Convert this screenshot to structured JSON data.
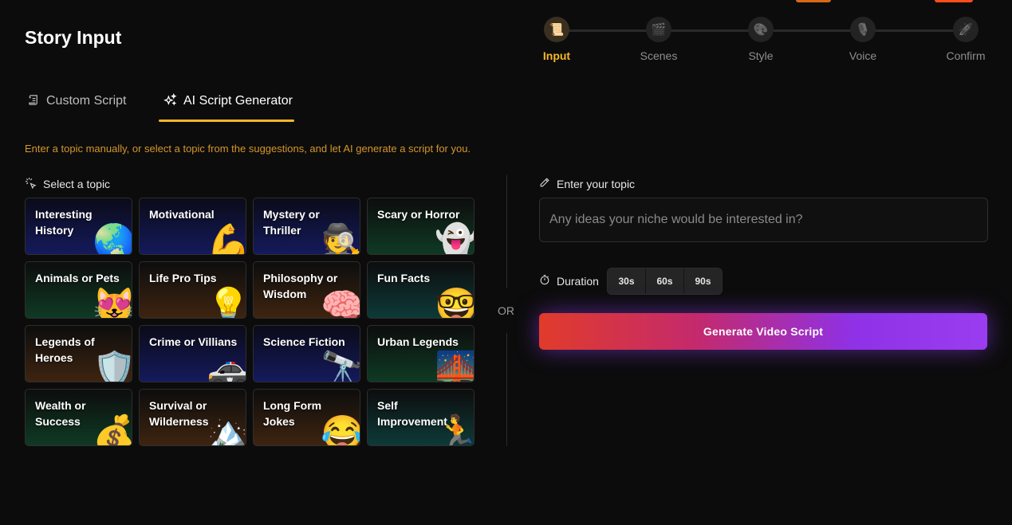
{
  "header": {
    "title": "Story Input"
  },
  "stepper": {
    "steps": [
      {
        "label": "Input",
        "icon": "📜",
        "active": true
      },
      {
        "label": "Scenes",
        "icon": "🎬",
        "active": false
      },
      {
        "label": "Style",
        "icon": "🎨",
        "active": false
      },
      {
        "label": "Voice",
        "icon": "🎙️",
        "active": false
      },
      {
        "label": "Confirm",
        "icon": "🚀",
        "active": false
      }
    ]
  },
  "tabs": {
    "custom_script": "Custom Script",
    "ai_script_generator": "AI Script Generator"
  },
  "hint": "Enter a topic manually, or select a topic from the suggestions, and let AI generate a script for you.",
  "topics": {
    "label": "Select a topic",
    "items": [
      {
        "title": "Interesting History",
        "emoji": "🌏"
      },
      {
        "title": "Motivational",
        "emoji": "💪"
      },
      {
        "title": "Mystery or Thriller",
        "emoji": "🕵️"
      },
      {
        "title": "Scary or Horror",
        "emoji": "👻"
      },
      {
        "title": "Animals or Pets",
        "emoji": "😻"
      },
      {
        "title": "Life Pro Tips",
        "emoji": "💡"
      },
      {
        "title": "Philosophy or Wisdom",
        "emoji": "🧠"
      },
      {
        "title": "Fun Facts",
        "emoji": "🤓"
      },
      {
        "title": "Legends of Heroes",
        "emoji": "🛡️"
      },
      {
        "title": "Crime or Villians",
        "emoji": "🚓"
      },
      {
        "title": "Science Fiction",
        "emoji": "🔭"
      },
      {
        "title": "Urban Legends",
        "emoji": "🌉"
      },
      {
        "title": "Wealth or Success",
        "emoji": "💰"
      },
      {
        "title": "Survival or Wilderness",
        "emoji": "🏔️"
      },
      {
        "title": "Long Form Jokes",
        "emoji": "😂"
      },
      {
        "title": "Self Improvement",
        "emoji": "🏃"
      }
    ]
  },
  "divider": {
    "or_text": "OR"
  },
  "topic_input": {
    "label": "Enter your topic",
    "placeholder": "Any ideas your niche would be interested in?",
    "value": ""
  },
  "duration": {
    "label": "Duration",
    "options": [
      "30s",
      "60s",
      "90s"
    ]
  },
  "generate_button": {
    "label": "Generate Video Script"
  },
  "colors": {
    "accent": "#f5b829",
    "hint": "#d4962a",
    "gradient_start": "#e13b2b",
    "gradient_end": "#9a3cf0"
  }
}
